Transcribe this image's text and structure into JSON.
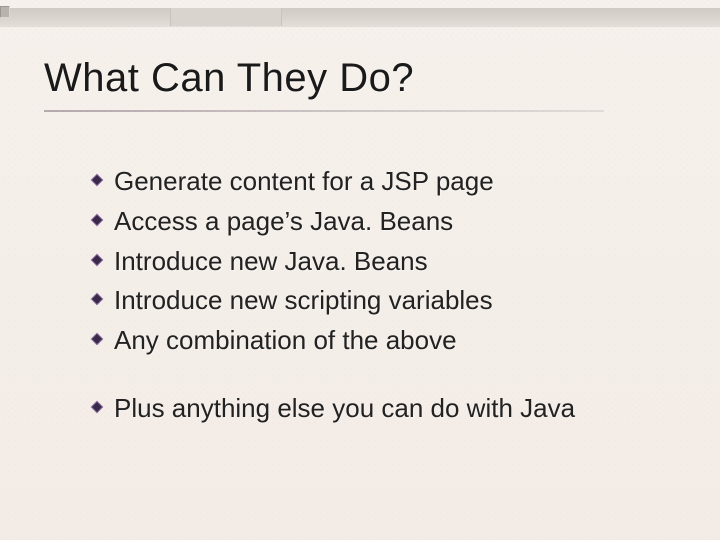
{
  "title": "What Can They Do?",
  "bullets_group1": [
    "Generate content for a JSP page",
    "Access a page’s Java. Beans",
    "Introduce new Java. Beans",
    "Introduce new scripting variables",
    "Any combination of the above"
  ],
  "bullets_group2": [
    "Plus anything else you can do with Java"
  ]
}
